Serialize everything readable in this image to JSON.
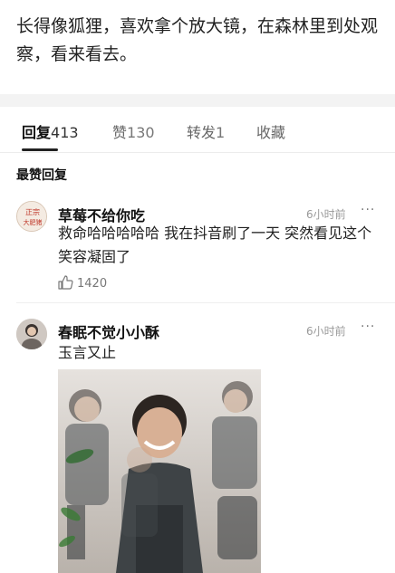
{
  "post": {
    "text": "长得像狐狸，喜欢拿个放大镜，在森林里到处观察，看来看去。"
  },
  "tabs": [
    {
      "label": "回复",
      "count": "413",
      "active": true
    },
    {
      "label": "赞",
      "count": "130",
      "active": false
    },
    {
      "label": "转发",
      "count": "1",
      "active": false
    },
    {
      "label": "收藏",
      "count": "",
      "active": false
    }
  ],
  "section": {
    "title": "最赞回复"
  },
  "comments": [
    {
      "username": "草莓不给你吃",
      "avatar_text": "正宗大肥猪",
      "time": "6小时前",
      "more": "···",
      "text": "救命哈哈哈哈哈 我在抖音刷了一天 突然看见这个 笑容凝固了",
      "likes": "1420"
    },
    {
      "username": "春眠不觉小小酥",
      "time": "6小时前",
      "more": "···",
      "text": "玉言又止"
    }
  ],
  "colors": {
    "accent": "#222222",
    "muted": "#9a9a9a",
    "background": "#ffffff"
  }
}
